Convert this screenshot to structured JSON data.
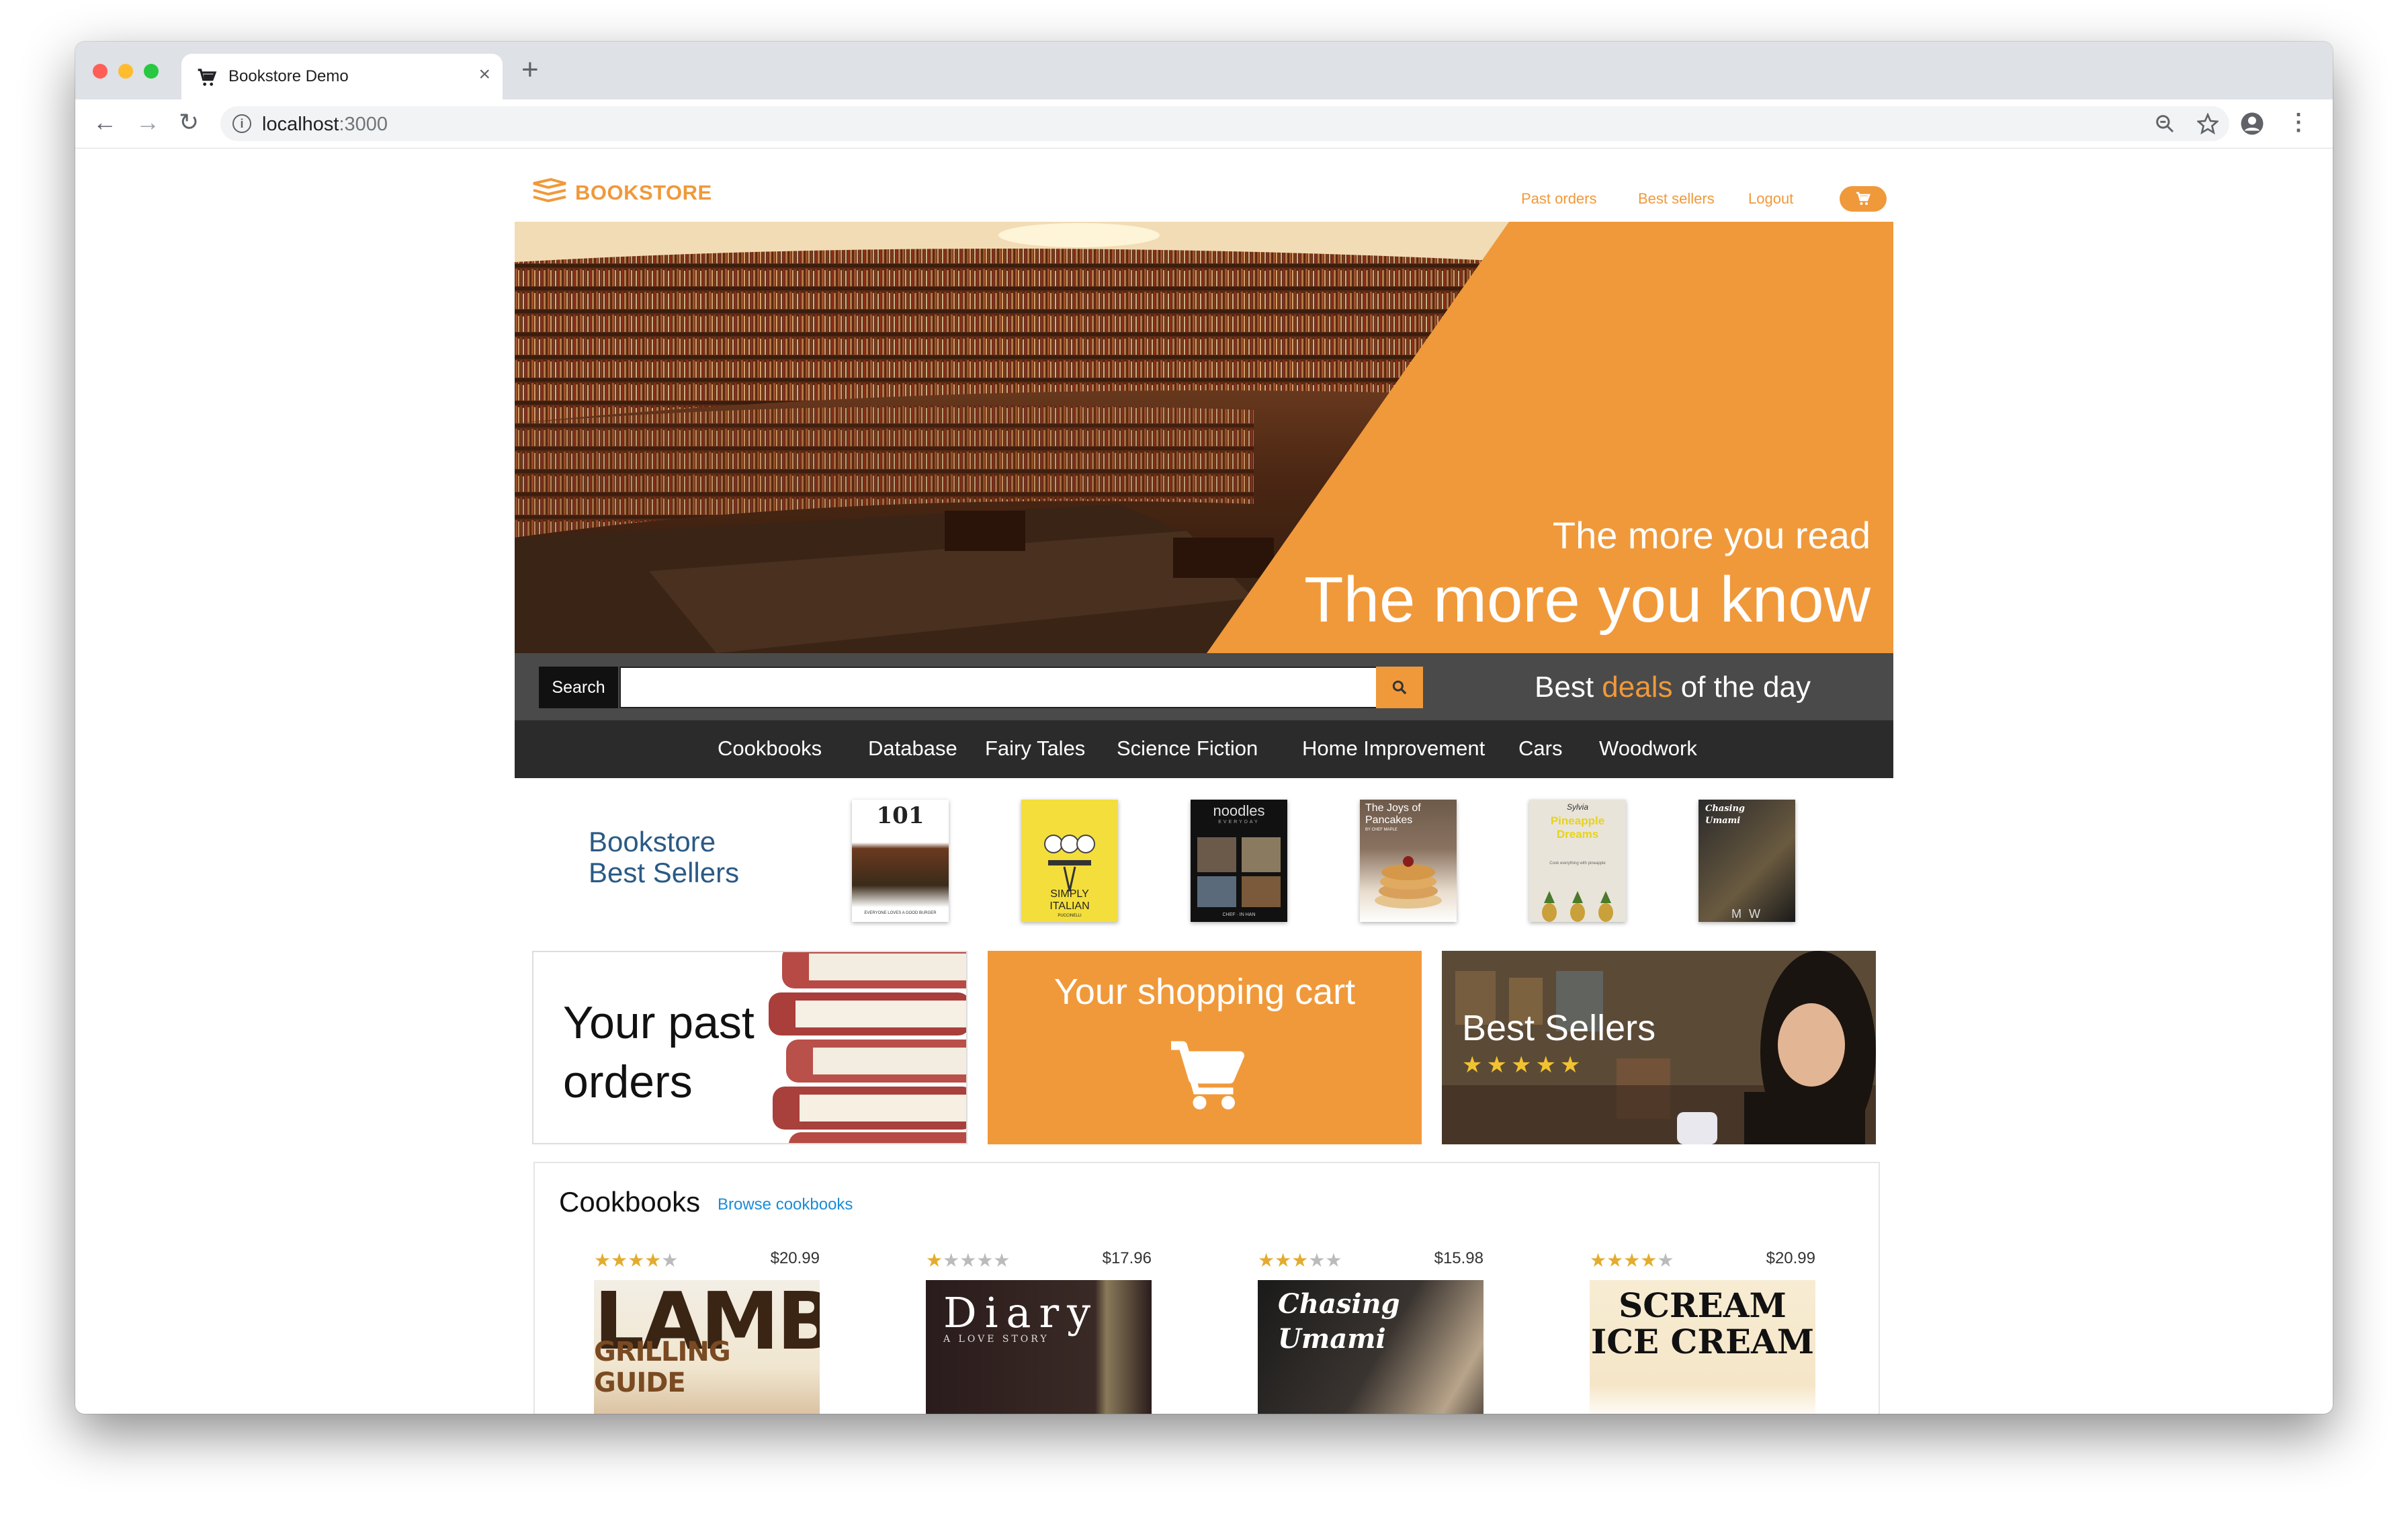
{
  "browser": {
    "tab_title": "Bookstore Demo",
    "new_tab": "+",
    "url_host": "localhost",
    "url_port": ":3000"
  },
  "header": {
    "brand": "BOOKSTORE",
    "nav": [
      "Past orders",
      "Best sellers",
      "Logout"
    ]
  },
  "hero": {
    "line1": "The more you read",
    "line2": "The more you know"
  },
  "search": {
    "label": "Search",
    "value": "",
    "deals_prefix": "Best ",
    "deals_highlight": "deals",
    "deals_suffix": " of the day"
  },
  "categories": [
    "Cookbooks",
    "Database",
    "Fairy Tales",
    "Science Fiction",
    "Home Improvement",
    "Cars",
    "Woodwork"
  ],
  "best_sellers": {
    "line1": "Bookstore",
    "line2": "Best Sellers",
    "books": [
      {
        "top": "101",
        "mid": "burgers",
        "bottom": "EVERYONE LOVES A GOOD BURGER"
      },
      {
        "top": "SIMPLY",
        "mid": "ITALIAN",
        "bottom": "PUCCINELLI"
      },
      {
        "top": "noodles",
        "mid": "EVERYDAY",
        "bottom": "CHEF · IN HAN"
      },
      {
        "top": "The Joys of",
        "mid": "Pancakes",
        "bottom": "BY CHEF MAPLE"
      },
      {
        "top": "Sylvia",
        "mid": "Pineapple Dreams",
        "bottom": "Cook everything with pineapple"
      },
      {
        "top": "Chasing",
        "mid": "Umami",
        "bottom": "M W"
      }
    ]
  },
  "panels": {
    "past_orders_line1": "Your past",
    "past_orders_line2": "orders",
    "cart": "Your shopping cart",
    "best_sellers": "Best Sellers"
  },
  "cookbooks": {
    "title": "Cookbooks",
    "link": "Browse cookbooks",
    "items": [
      {
        "price": "$20.99",
        "rating": 4,
        "cover_line1": "LAMB",
        "cover_line2": "GRILLING GUIDE"
      },
      {
        "price": "$17.96",
        "rating": 1,
        "cover_line1": "Diary",
        "cover_line2": "A LOVE STORY"
      },
      {
        "price": "$15.98",
        "rating": 3,
        "cover_line1": "Chasing",
        "cover_line2": "Umami"
      },
      {
        "price": "$20.99",
        "rating": 4,
        "cover_line1": "SCREAM",
        "cover_line2": "ICE CREAM"
      }
    ]
  },
  "colors": {
    "brand_orange": "#f0993a",
    "search_bar": "#4a4a4a",
    "category_bar": "#2b2b2b",
    "best_seller_title": "#2b5a85",
    "link_blue": "#1a8cd8"
  },
  "icons": [
    "cart-icon",
    "close-icon",
    "back-icon",
    "forward-icon",
    "reload-icon",
    "info-icon",
    "zoom-icon",
    "star-icon",
    "account-icon",
    "menu-icon",
    "search-icon",
    "book-stack-icon"
  ]
}
